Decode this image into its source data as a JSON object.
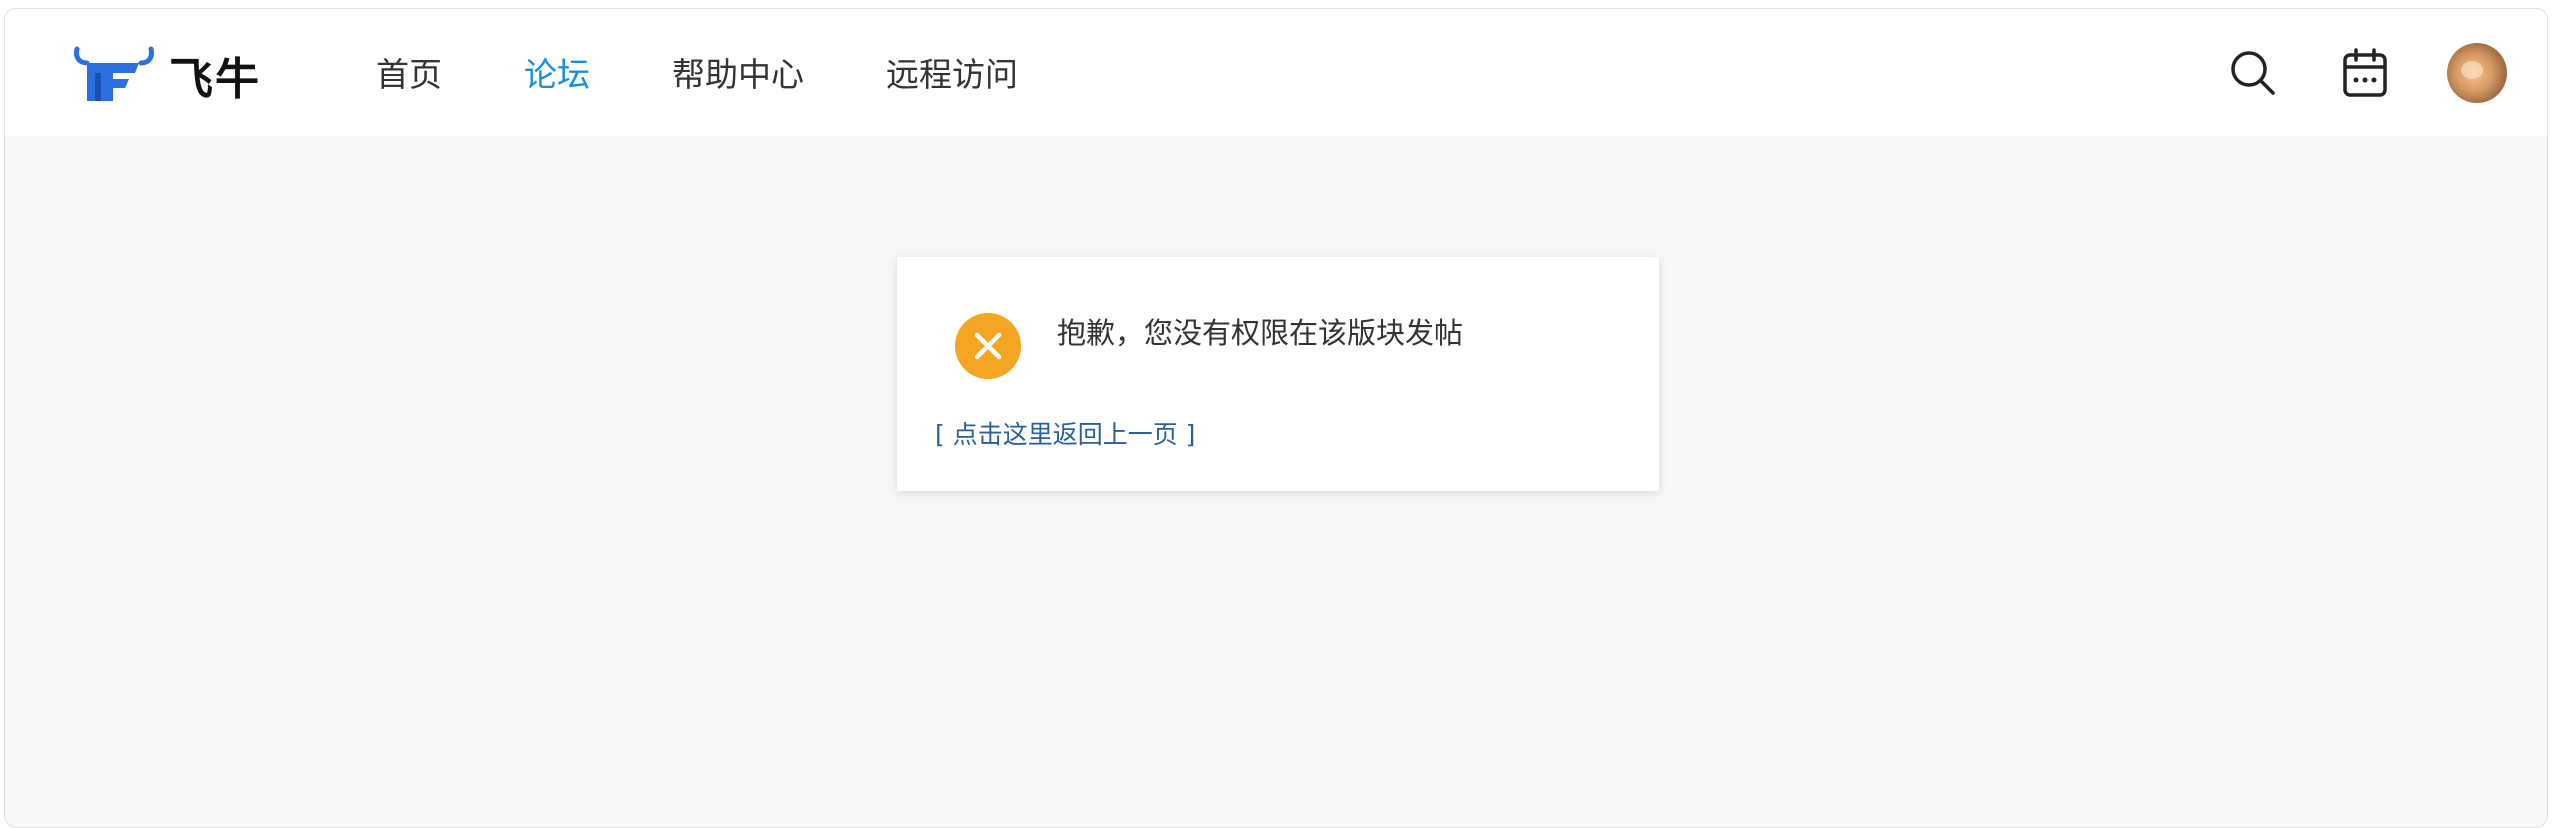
{
  "header": {
    "logo_text": "飞牛",
    "nav": [
      {
        "label": "首页",
        "active": false
      },
      {
        "label": "论坛",
        "active": true
      },
      {
        "label": "帮助中心",
        "active": false
      },
      {
        "label": "远程访问",
        "active": false
      }
    ],
    "icons": [
      "search-icon",
      "calendar-icon"
    ],
    "accent_color": "#1a8ee3"
  },
  "message": {
    "text": "抱歉，您没有权限在该版块发帖",
    "icon": "error-circle-icon",
    "icon_color": "#f5a524",
    "back_link": "[ 点击这里返回上一页 ]"
  }
}
